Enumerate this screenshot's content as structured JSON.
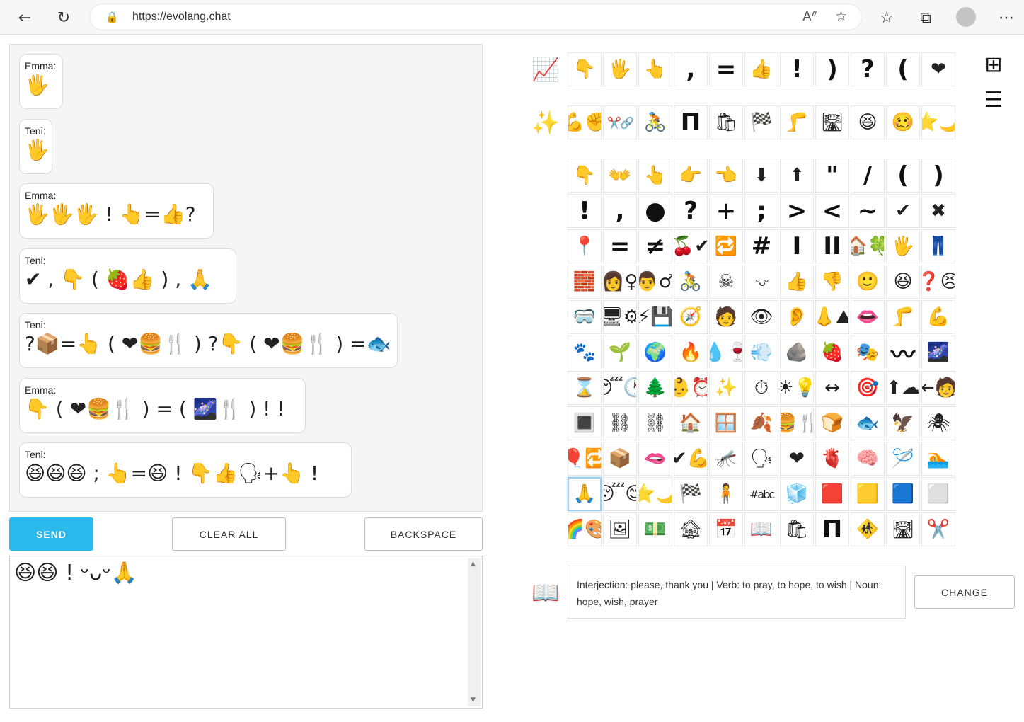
{
  "browser": {
    "url": "https://evolang.chat",
    "icons": [
      "back-icon",
      "refresh-icon",
      "lock-icon",
      "read-aloud-icon",
      "add-favorite-icon",
      "favorites-icon",
      "collections-icon",
      "avatar",
      "more-icon"
    ]
  },
  "chat": {
    "messages": [
      {
        "sender": "Emma:",
        "body": "🖐"
      },
      {
        "sender": "Teni:",
        "body": "🖐"
      },
      {
        "sender": "Emma:",
        "body": "🖐🖐🖐 ! 👆=👍?"
      },
      {
        "sender": "Teni:",
        "body": "✔ , 👇 ( 🍓👍 ) , 🙏"
      },
      {
        "sender": "Teni:",
        "body": "?📦=👆 ( ❤🍔🍴 ) ?👇 ( ❤🍔🍴 ) =🐟"
      },
      {
        "sender": "Emma:",
        "body": "👇 ( ❤🍔🍴 ) = ( 🌌🍴 ) ! !"
      },
      {
        "sender": "Teni:",
        "body": "😆😆😆 ; 👆=😆 ! 👇👍🗣+👆 !"
      }
    ]
  },
  "buttons": {
    "send": "SEND",
    "clear_all": "CLEAR ALL",
    "backspace": "BACKSPACE",
    "change": "CHANGE"
  },
  "composer": {
    "value": "😆😆 ! ᵕᴗᵕ🙏"
  },
  "palette": {
    "row_icons": [
      "📈",
      "✨"
    ],
    "recent": [
      "👇",
      "🖐",
      "👆",
      ",",
      "=",
      "👍",
      "!",
      ")",
      "?",
      "(",
      "❤"
    ],
    "featured": [
      "💪✊",
      "✂️🔗",
      "🚴",
      "Π",
      "🛍",
      "🏁",
      "🦵",
      "🛣",
      "😆",
      "🥴",
      "⭐🌙"
    ],
    "grid": [
      [
        "👇",
        "👐",
        "👆",
        "👉",
        "👈",
        "⬇",
        "⬆",
        "\"",
        "/",
        "(",
        ")"
      ],
      [
        "!",
        ",",
        "●",
        "?",
        "+",
        ";",
        ">",
        "<",
        "~",
        "✔",
        "✖"
      ],
      [
        "📍",
        "=",
        "≠",
        "🍒✔",
        "🔁",
        "#",
        "I",
        "II",
        "🏠🍀",
        "🖐",
        "👖"
      ],
      [
        "🧱",
        "👩♀",
        "👨♂",
        "🚴",
        "☠",
        "ᵕᴗᵕ",
        "👍",
        "👎",
        "🙂",
        "😆",
        "❓😣"
      ],
      [
        "🥽",
        "🖥⚙",
        "⚡💾",
        "🧭",
        "🧑",
        "👁",
        "👂",
        "👃⛰",
        "👄",
        "🦵",
        "💪"
      ],
      [
        "🐾",
        "🌱",
        "🌍",
        "🔥",
        "💧🍷",
        "💨",
        "🪨",
        "🍓",
        "🎭",
        "〰",
        "🌌"
      ],
      [
        "⌛",
        "😴🕐",
        "🌲",
        "👶⏰",
        "✨",
        "⏱",
        "☀💡",
        "↔",
        "🎯",
        "⬆☁",
        "⇤🧑"
      ],
      [
        "🔳",
        "⛓",
        "⛓",
        "🏠",
        "🪟",
        "🍂",
        "🍔🍴",
        "🍞",
        "🐟",
        "🦅",
        "🕷"
      ],
      [
        "🎈🔁",
        "📦",
        "🫦",
        "✔💪",
        "🦟",
        "🗣",
        "❤",
        "🫀",
        "🧠",
        "🪡",
        "🏊"
      ],
      [
        "🙏",
        "😴😊",
        "⭐🌙",
        "🏁",
        "🧍",
        "#abc",
        "🧊",
        "🟥",
        "🟨",
        "🟦",
        "⬜"
      ],
      [
        "🌈🎨",
        "🖼",
        "💵",
        "🏚",
        "📅",
        "📖",
        "🛍",
        "Π",
        "🚸",
        "🛣",
        "✂️"
      ]
    ],
    "selected": "🙏"
  },
  "definition": {
    "text": "Interjection: please, thank you | Verb: to pray, to hope, to wish | Noun: hope, wish, prayer",
    "icon": "book-icon"
  }
}
